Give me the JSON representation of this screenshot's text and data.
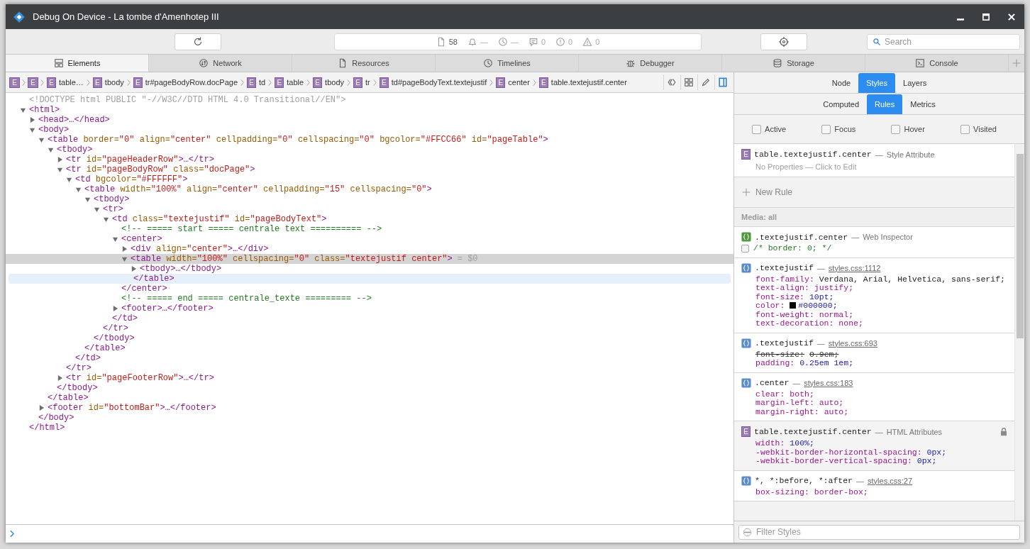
{
  "window": {
    "title": "Debug On Device - La tombe d'Amenhotep III"
  },
  "toolbar": {
    "status": [
      {
        "kind": "document",
        "text": "58"
      },
      {
        "kind": "bell",
        "text": "—"
      },
      {
        "kind": "clock",
        "text": "—"
      },
      {
        "kind": "log",
        "text": "0"
      },
      {
        "kind": "error",
        "text": "0"
      },
      {
        "kind": "warning",
        "text": "0"
      }
    ],
    "search": {
      "placeholder": "Search"
    }
  },
  "tabs": [
    {
      "kind": "elements",
      "label": "Elements",
      "selected": true
    },
    {
      "kind": "network",
      "label": "Network",
      "selected": false
    },
    {
      "kind": "resources",
      "label": "Resources",
      "selected": false
    },
    {
      "kind": "timelines",
      "label": "Timelines",
      "selected": false
    },
    {
      "kind": "debugger",
      "label": "Debugger",
      "selected": false
    },
    {
      "kind": "storage",
      "label": "Storage",
      "selected": false
    },
    {
      "kind": "console",
      "label": "Console",
      "selected": false
    }
  ],
  "breadcrumbs": [
    {
      "badge": "E"
    },
    {
      "badge": "E"
    },
    {
      "badge": "E",
      "label": "table…"
    },
    {
      "badge": "E",
      "label": "tbody"
    },
    {
      "badge": "E",
      "label": "tr#pageBodyRow.docPage"
    },
    {
      "badge": "E",
      "label": "td"
    },
    {
      "badge": "E",
      "label": "table"
    },
    {
      "badge": "E",
      "label": "tbody"
    },
    {
      "badge": "E",
      "label": "tr"
    },
    {
      "badge": "E",
      "label": "td#pageBodyText.textejustif"
    },
    {
      "badge": "E",
      "label": "center"
    },
    {
      "badge": "E",
      "label": "table.textejustif.center"
    }
  ],
  "sidebar_toggle": {
    "on": true
  },
  "dom_tree": [
    {
      "kind": "doctype",
      "text": "<!DOCTYPE html PUBLIC \"-//W3C//DTD HTML 4.0 Transitional//EN\">",
      "selected": false
    },
    {
      "kind": "element",
      "open": "<html>",
      "expanded": true,
      "selected": false,
      "close": "</html>",
      "children": [
        {
          "kind": "element",
          "open": "<head>…</head>",
          "expanded": false,
          "selected": false
        },
        {
          "kind": "element",
          "open": "<body>",
          "expanded": true,
          "selected": false,
          "close": "</body>",
          "children": [
            {
              "kind": "element",
              "open": "<table border=\"0\" align=\"center\" cellpadding=\"0\" cellspacing=\"0\" bgcolor=\"#FFCC66\" id=\"pageTable\">",
              "expanded": true,
              "selected": false,
              "close": "</table>",
              "children": [
                {
                  "kind": "element",
                  "open": "<tbody>",
                  "expanded": true,
                  "selected": false,
                  "close": "</tbody>",
                  "children": [
                    {
                      "kind": "element",
                      "open": "<tr id=\"pageHeaderRow\">…</tr>",
                      "expanded": false,
                      "selected": false
                    },
                    {
                      "kind": "element",
                      "open": "<tr id=\"pageBodyRow\" class=\"docPage\">",
                      "expanded": true,
                      "selected": false,
                      "close": "</tr>",
                      "children": [
                        {
                          "kind": "element",
                          "open": "<td bgcolor=\"#FFFFFF\">",
                          "expanded": true,
                          "selected": false,
                          "close": "</td>",
                          "children": [
                            {
                              "kind": "element",
                              "open": "<table width=\"100%\" align=\"center\" cellpadding=\"15\" cellspacing=\"0\">",
                              "expanded": true,
                              "selected": false,
                              "close": "</table>",
                              "children": [
                                {
                                  "kind": "element",
                                  "open": "<tbody>",
                                  "expanded": true,
                                  "selected": false,
                                  "close": "</tbody>",
                                  "children": [
                                    {
                                      "kind": "element",
                                      "open": "<tr>",
                                      "expanded": true,
                                      "selected": false,
                                      "close": "</tr>",
                                      "children": [
                                        {
                                          "kind": "element",
                                          "open": "<td class=\"textejustif\" id=\"pageBodyText\">",
                                          "expanded": true,
                                          "selected": false,
                                          "close": "</td>",
                                          "children": [
                                            {
                                              "kind": "comment",
                                              "text": "<!-- ===== start ===== centrale text ========== -->",
                                              "selected": false
                                            },
                                            {
                                              "kind": "element",
                                              "open": "<center>",
                                              "expanded": true,
                                              "selected": false,
                                              "close": "</center>",
                                              "children": [
                                                {
                                                  "kind": "element",
                                                  "open": "<div align=\"center\">…</div>",
                                                  "expanded": false,
                                                  "selected": false
                                                },
                                                {
                                                  "kind": "element",
                                                  "open": "<table width=\"100%\" cellspacing=\"0\" class=\"textejustif center\">",
                                                  "suffix": "= $0",
                                                  "expanded": true,
                                                  "selected": true,
                                                  "close": "</table>",
                                                  "close_hovered": true,
                                                  "children": [
                                                    {
                                                      "kind": "element",
                                                      "open": "<tbody>…</tbody>",
                                                      "expanded": false,
                                                      "selected": false
                                                    }
                                                  ]
                                                }
                                              ]
                                            },
                                            {
                                              "kind": "comment",
                                              "text": "<!-- ===== end ===== centrale_texte ========= -->",
                                              "selected": false
                                            },
                                            {
                                              "kind": "element",
                                              "open": "<footer>…</footer>",
                                              "expanded": false,
                                              "selected": false
                                            }
                                          ]
                                        }
                                      ]
                                    }
                                  ]
                                }
                              ]
                            }
                          ]
                        }
                      ]
                    },
                    {
                      "kind": "element",
                      "open": "<tr id=\"pageFooterRow\">…</tr>",
                      "expanded": false,
                      "selected": false
                    }
                  ]
                }
              ]
            },
            {
              "kind": "element",
              "open": "<footer id=\"bottomBar\">…</footer>",
              "expanded": false,
              "selected": false
            }
          ]
        }
      ]
    }
  ],
  "sidebar": {
    "tabs": [
      {
        "label": "Node",
        "selected": false
      },
      {
        "label": "Styles",
        "selected": true
      },
      {
        "label": "Layers",
        "selected": false
      }
    ],
    "subtabs": [
      {
        "label": "Computed",
        "selected": false
      },
      {
        "label": "Rules",
        "selected": true
      },
      {
        "label": "Metrics",
        "selected": false
      }
    ],
    "pseudo_classes": [
      {
        "label": "Active",
        "checked": false
      },
      {
        "label": "Focus",
        "checked": false
      },
      {
        "label": "Hover",
        "checked": false
      },
      {
        "label": "Visited",
        "checked": false
      }
    ],
    "sections": [
      {
        "kind": "element_rule",
        "badge": "E",
        "selector": "table.textejustif.center",
        "separator": "—",
        "origin": "Style Attribute",
        "origin_link": false,
        "empty_text": "No Properties — Click to Edit"
      },
      {
        "kind": "new_rule",
        "label": "New Rule"
      },
      {
        "kind": "media",
        "label": "Media: all"
      },
      {
        "kind": "inspector_rule",
        "selector": ".textejustif.center",
        "separator": "—",
        "origin": "Web Inspector",
        "origin_link": false,
        "properties": [
          {
            "kind": "comment",
            "text": "/* border: 0; */",
            "checked": false
          }
        ]
      },
      {
        "kind": "stylesheet_rule",
        "selector": ".textejustif",
        "separator": "—",
        "origin": "styles.css:1112",
        "origin_link": true,
        "properties": [
          {
            "kind": "plain",
            "name": "font-family:",
            "value": "Verdana, Arial, Helvetica, sans-serif;",
            "overridden": false
          },
          {
            "kind": "keyword",
            "name": "text-align:",
            "value": "justify;",
            "overridden": false
          },
          {
            "kind": "number",
            "name": "font-size:",
            "value": "10pt;",
            "overridden": false
          },
          {
            "kind": "number",
            "name": "color:",
            "value": "#000000;",
            "color": "#000000",
            "overridden": false
          },
          {
            "kind": "keyword",
            "name": "font-weight:",
            "value": "normal;",
            "overridden": false
          },
          {
            "kind": "keyword",
            "name": "text-decoration:",
            "value": "none;",
            "overridden": false
          }
        ]
      },
      {
        "kind": "stylesheet_rule",
        "selector": ".textejustif",
        "separator": "—",
        "origin": "styles.css:693",
        "origin_link": true,
        "properties": [
          {
            "kind": "number",
            "name": "font-size:",
            "value": "0.9em;",
            "overridden": true
          },
          {
            "kind": "number",
            "name": "padding:",
            "value": "0.25em 1em;",
            "overridden": false
          }
        ]
      },
      {
        "kind": "stylesheet_rule",
        "selector": ".center",
        "separator": "—",
        "origin": "styles.css:183",
        "origin_link": true,
        "properties": [
          {
            "kind": "keyword",
            "name": "clear:",
            "value": "both;",
            "overridden": false
          },
          {
            "kind": "keyword",
            "name": "margin-left:",
            "value": "auto;",
            "overridden": false
          },
          {
            "kind": "keyword",
            "name": "margin-right:",
            "value": "auto;",
            "overridden": false
          }
        ]
      },
      {
        "kind": "element_rule",
        "badge": "E",
        "selector": "table.textejustif.center",
        "separator": "—",
        "origin": "HTML Attributes",
        "origin_link": false,
        "locked": true,
        "properties": [
          {
            "kind": "number",
            "name": "width:",
            "value": "100%;",
            "overridden": false
          },
          {
            "kind": "number",
            "name": "-webkit-border-horizontal-spacing:",
            "value": "0px;",
            "overridden": false
          },
          {
            "kind": "number",
            "name": "-webkit-border-vertical-spacing:",
            "value": "0px;",
            "overridden": false
          }
        ]
      },
      {
        "kind": "stylesheet_rule",
        "selector": "*, *:before, *:after",
        "separator": "—",
        "origin": "styles.css:27",
        "origin_link": true,
        "properties": [
          {
            "kind": "keyword",
            "name": "box-sizing:",
            "value": "border-box;",
            "overridden": false
          }
        ]
      }
    ],
    "filter": {
      "placeholder": "Filter Styles"
    }
  }
}
